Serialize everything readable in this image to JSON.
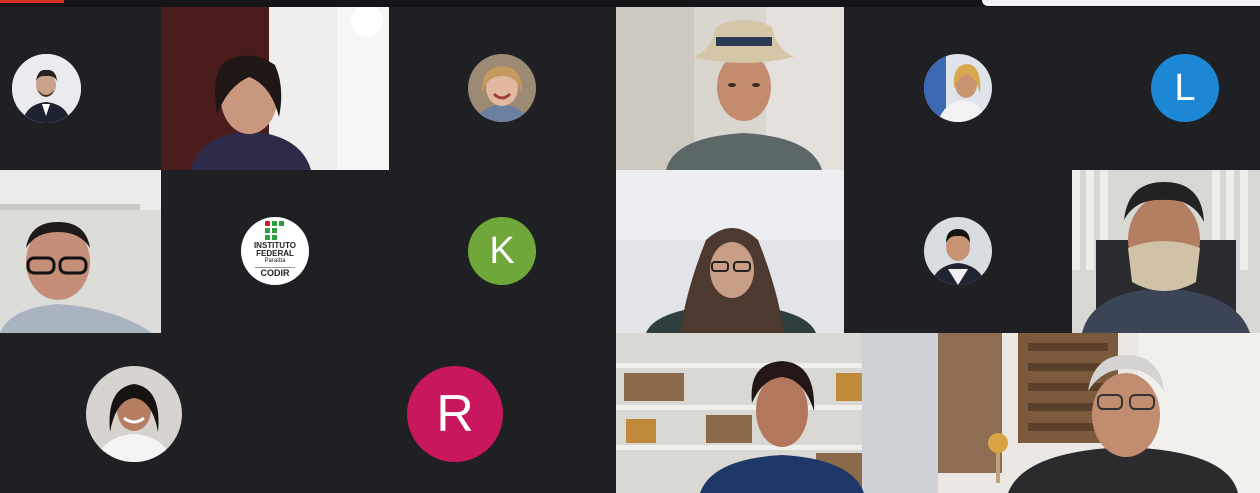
{
  "meeting": {
    "participants": [
      {
        "id": "p1",
        "type": "photo-avatar"
      },
      {
        "id": "p2",
        "type": "video"
      },
      {
        "id": "p3",
        "type": "photo-avatar"
      },
      {
        "id": "p4",
        "type": "video"
      },
      {
        "id": "p5",
        "type": "photo-avatar"
      },
      {
        "id": "p6",
        "type": "letter-avatar",
        "initial": "L",
        "color": "#1c87d4"
      },
      {
        "id": "p7",
        "type": "video"
      },
      {
        "id": "p8",
        "type": "logo-avatar",
        "logo_line1": "INSTITUTO",
        "logo_line2": "FEDERAL",
        "logo_line3": "Paraíba",
        "logo_line4": "CODIR"
      },
      {
        "id": "p9",
        "type": "letter-avatar",
        "initial": "K",
        "color": "#6fa73a"
      },
      {
        "id": "p10",
        "type": "video"
      },
      {
        "id": "p11",
        "type": "photo-avatar"
      },
      {
        "id": "p12",
        "type": "video"
      },
      {
        "id": "p13",
        "type": "photo-avatar"
      },
      {
        "id": "p14",
        "type": "letter-avatar",
        "initial": "R",
        "color": "#c8175c"
      },
      {
        "id": "p15",
        "type": "video"
      },
      {
        "id": "p16",
        "type": "video"
      }
    ]
  },
  "colors": {
    "background": "#1f2023",
    "ifpb_green": "#2f9e41",
    "ifpb_red": "#cc1f1f"
  }
}
